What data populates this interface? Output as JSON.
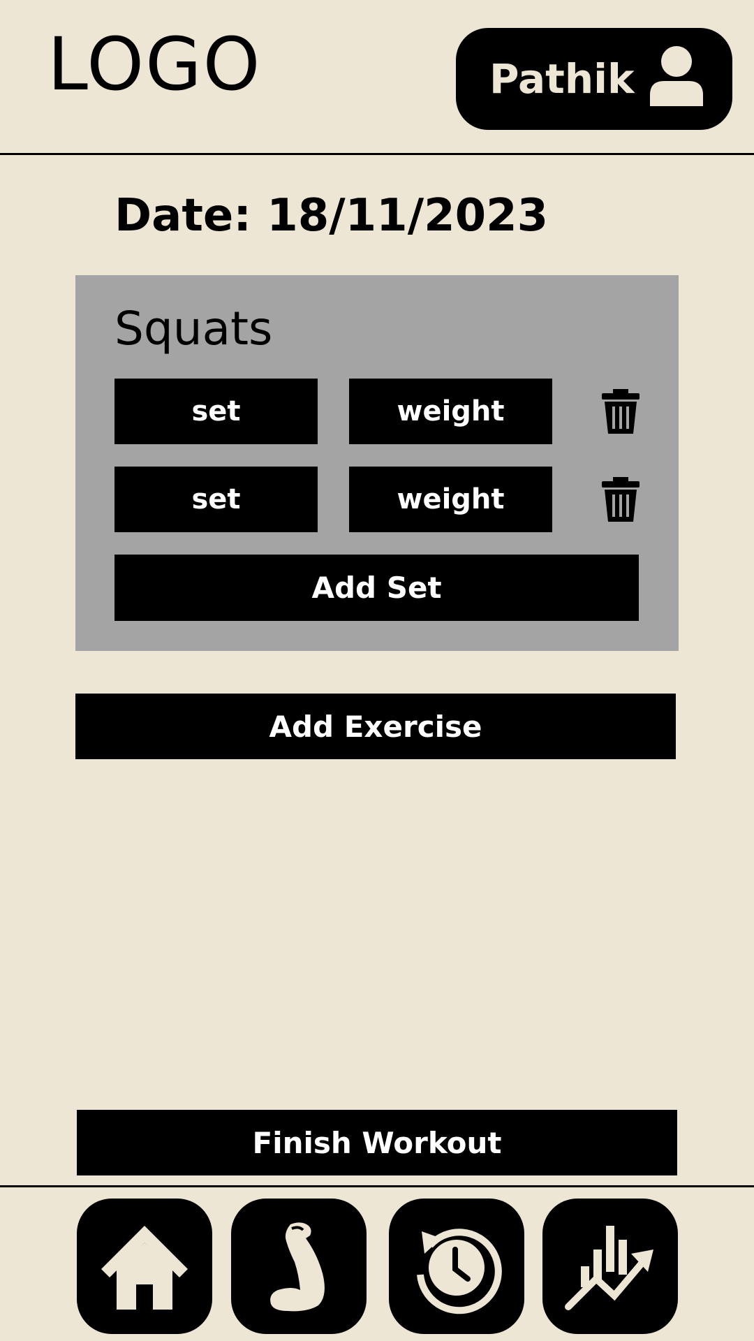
{
  "header": {
    "logo_text": "LOGO",
    "profile_name": "Pathik",
    "profile_icon": "user-icon"
  },
  "workout": {
    "date_text": "Date: 18/11/2023",
    "exercise": {
      "name": "Squats",
      "sets": [
        {
          "set_label": "set",
          "weight_label": "weight",
          "delete_icon": "trash-icon"
        },
        {
          "set_label": "set",
          "weight_label": "weight",
          "delete_icon": "trash-icon"
        }
      ],
      "add_set_label": "Add Set"
    },
    "add_exercise_label": "Add Exercise",
    "finish_label": "Finish Workout"
  },
  "nav": {
    "items": [
      {
        "name": "home",
        "icon": "home-icon"
      },
      {
        "name": "workouts",
        "icon": "flexed-arm-icon"
      },
      {
        "name": "history",
        "icon": "history-clock-icon"
      },
      {
        "name": "progress",
        "icon": "chart-trend-icon"
      }
    ]
  },
  "colors": {
    "background": "#EEE6D4",
    "card": "#A4A4A4",
    "primary": "#000000",
    "on_primary": "#FFFFFF"
  }
}
